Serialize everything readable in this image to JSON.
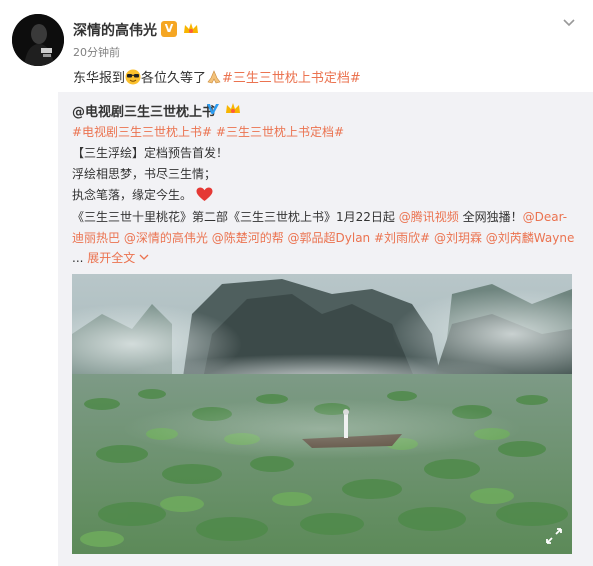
{
  "post": {
    "author": "深情的高伟光",
    "verified_badge": "V",
    "time": "20分钟前",
    "text_before": "东华报到",
    "text_after": "各位久等了",
    "hashtag": "#三生三世枕上书定档#",
    "icons": {
      "avatar": "avatar-portrait",
      "verified": "v-badge-icon",
      "member": "crown-badge-icon",
      "menu": "chevron-down-icon",
      "emoji1": "sunglasses-emoji-icon",
      "emoji2": "praying-hands-emoji-icon"
    }
  },
  "repost": {
    "author": "@电视剧三生三世枕上书",
    "hashtags": "#电视剧三生三世枕上书# #三生三世枕上书定档#",
    "line1": "【三生浮绘】定档预告首发！",
    "line2": "浮绘相思梦，书尽三生情；",
    "line3": "执念笔落，缘定今生。",
    "line4_pre": "《三生三世十里桃花》第二部《三生三世枕上书》1月22日起",
    "line4_mention": "@腾讯视频",
    "line4_mid": " 全网独播！",
    "line4_mention2": "@Dear-",
    "line5_mention_a": "迪丽热巴",
    "line5_mention_b": "@深情的高伟光",
    "line5_mention_c": "@陈楚河的帮",
    "line5_mention_d": "@郭品超Dylan",
    "line5_hashtag": "#刘雨欣#",
    "line5_mention_e": "@刘玥霖",
    "line5_mention_f": "@刘芮麟Wayne",
    "ellipsis": "...",
    "expand": "展开全文",
    "icons": {
      "heart": "heart-emoji-icon",
      "expand": "chevron-down-icon",
      "video_control": "fullscreen-icon"
    }
  },
  "colors": {
    "link": "#eb7350",
    "repost_bg": "#f2f2f5",
    "text": "#333333",
    "time": "#808080"
  }
}
